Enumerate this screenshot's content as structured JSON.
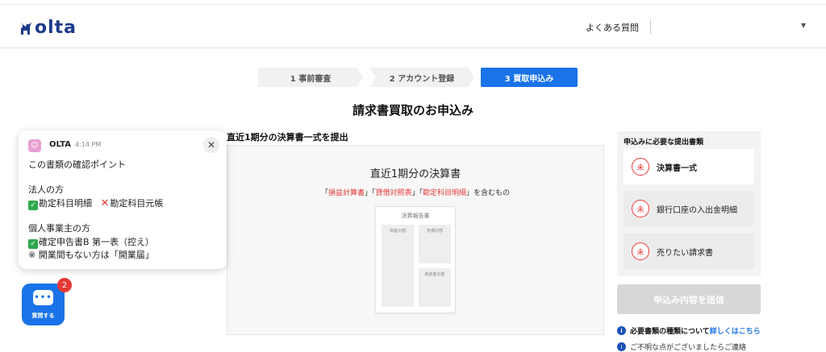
{
  "header": {
    "logo_text": "olta",
    "faq_link": "よくある質問",
    "brand_color": "#1e3a8a"
  },
  "steps": [
    {
      "label": "1 事前審査",
      "state": "done"
    },
    {
      "label": "2 アカウント登録",
      "state": "done"
    },
    {
      "label": "3 買取申込み",
      "state": "active"
    }
  ],
  "page_title": "請求書買取のお申込み",
  "document": {
    "section_label": "直近1期分の決算書一式を提出",
    "title": "直近1期分の決算書",
    "sub_prefix": "「",
    "sub_item1": "損益計算書",
    "sub_sep1": "」「",
    "sub_item2": "貸借対照表",
    "sub_sep2": "」「",
    "sub_item3": "勘定科目明細",
    "sub_suffix": "」を含むもの",
    "paper_title": "決算報告書",
    "paper_box1": "資産の部",
    "paper_box2": "負債の部",
    "paper_box3": "純資産の部"
  },
  "side": {
    "title": "申込みに必要な提出書類",
    "items": [
      {
        "mark": "未",
        "label": "決算書一式"
      },
      {
        "mark": "未",
        "label": "銀行口座の入出金明細"
      },
      {
        "mark": "未",
        "label": "売りたい請求書"
      }
    ],
    "submit_label": "申込み内容を送信",
    "info_text": "必要書類の種類について",
    "info_link": "詳しくはこちら",
    "info2_text": "ご不明な点がございましたらご連絡"
  },
  "popup": {
    "sender": "OLTA",
    "time": "4:14 PM",
    "heading": "この書類の確認ポイント",
    "corp_label": "法人の方",
    "corp_ok": "勘定科目明細",
    "corp_ng": "勘定科目元帳",
    "indiv_label": "個人事業主の方",
    "indiv_ok": "確定申告書B 第一表（控え）",
    "indiv_note": "※ 開業間もない方は「開業届」"
  },
  "chat": {
    "label": "質問する",
    "badge_count": "2",
    "accent": "#1a73e8"
  }
}
